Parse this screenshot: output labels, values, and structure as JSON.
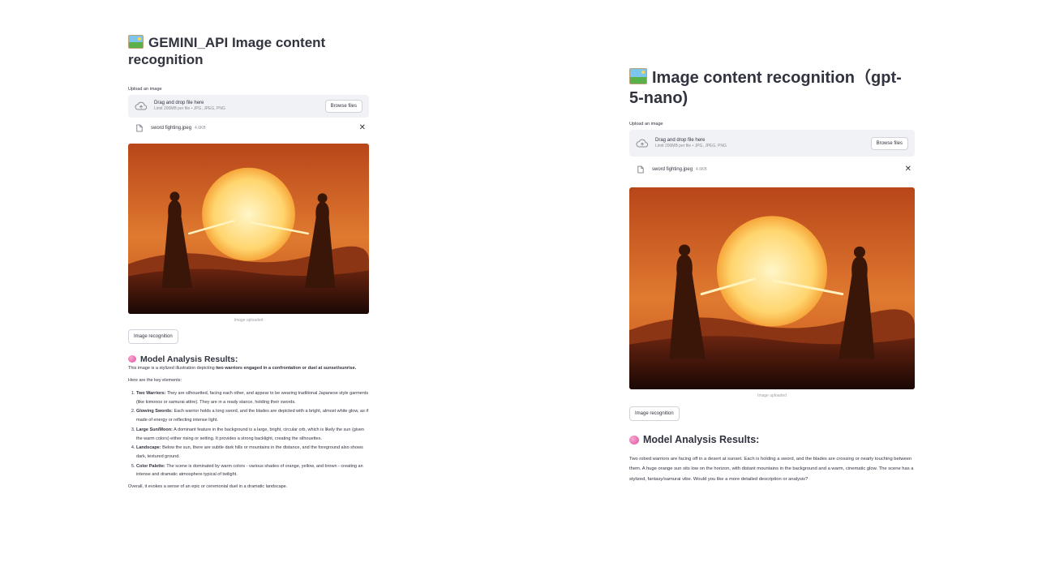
{
  "left": {
    "title": "GEMINI_API Image content recognition",
    "upload_label": "Upload an image",
    "dropzone": {
      "main": "Drag and drop file here",
      "sub": "Limit 200MB per file • JPG, JPEG, PNG",
      "browse_label": "Browse files"
    },
    "file": {
      "name": "sword fighting.jpeg",
      "size": "4.6KB"
    },
    "image_caption": "Image uploaded",
    "recognize_label": "Image recognition",
    "results_heading": "Model Analysis Results:",
    "intro_pre": "This image is a stylized illustration depicting ",
    "intro_bold": "two warriors engaged in a confrontation or duel at sunset/sunrise.",
    "key_elements": "Here are the key elements:",
    "items": [
      {
        "term": "Two Warriors:",
        "text": " They are silhouetted, facing each other, and appear to be wearing traditional Japanese style garments (like kimonos or samurai attire). They are in a ready stance, holding their swords."
      },
      {
        "term": "Glowing Swords:",
        "text": " Each warrior holds a long sword, and the blades are depicted with a bright, almost white glow, as if made of energy or reflecting intense light."
      },
      {
        "term": "Large Sun/Moon:",
        "text": " A dominant feature in the background is a large, bright, circular orb, which is likely the sun (given the warm colors) either rising or setting. It provides a strong backlight, creating the silhouettes."
      },
      {
        "term": "Landscape:",
        "text": " Below the sun, there are subtle dark hills or mountains in the distance, and the foreground also shows dark, textured ground."
      },
      {
        "term": "Color Palette:",
        "text": " The scene is dominated by warm colors - various shades of orange, yellow, and brown - creating an intense and dramatic atmosphere typical of twilight."
      }
    ],
    "outro": "Overall, it evokes a sense of an epic or ceremonial duel in a dramatic landscape."
  },
  "right": {
    "title": "Image content recognition（gpt-5-nano)",
    "upload_label": "Upload an image",
    "dropzone": {
      "main": "Drag and drop file here",
      "sub": "Limit 200MB per file • JPG, JPEG, PNG",
      "browse_label": "Browse files"
    },
    "file": {
      "name": "sword fighting.jpeg",
      "size": "4.6KB"
    },
    "image_caption": "Image uploaded",
    "recognize_label": "Image recognition",
    "results_heading": "Model Analysis Results:",
    "result_text": "Two robed warriors are facing off in a desert at sunset. Each is holding a sword, and the blades are crossing or nearly touching between them. A huge orange sun sits low on the horizon, with distant mountains in the background and a warm, cinematic glow. The scene has a stylized, fantasy/samurai vibe. Would you like a more detailed description or analysis?"
  },
  "icons": {
    "title": "framed-picture-icon",
    "upload": "cloud-upload-icon",
    "file": "file-icon",
    "remove": "close-icon",
    "results": "brain-icon"
  },
  "colors": {
    "text": "#31333f",
    "dropzone_bg": "#f0f2f6",
    "muted": "#8b8d97",
    "sun": "#ffe9a0",
    "sky": "#c2541e"
  }
}
